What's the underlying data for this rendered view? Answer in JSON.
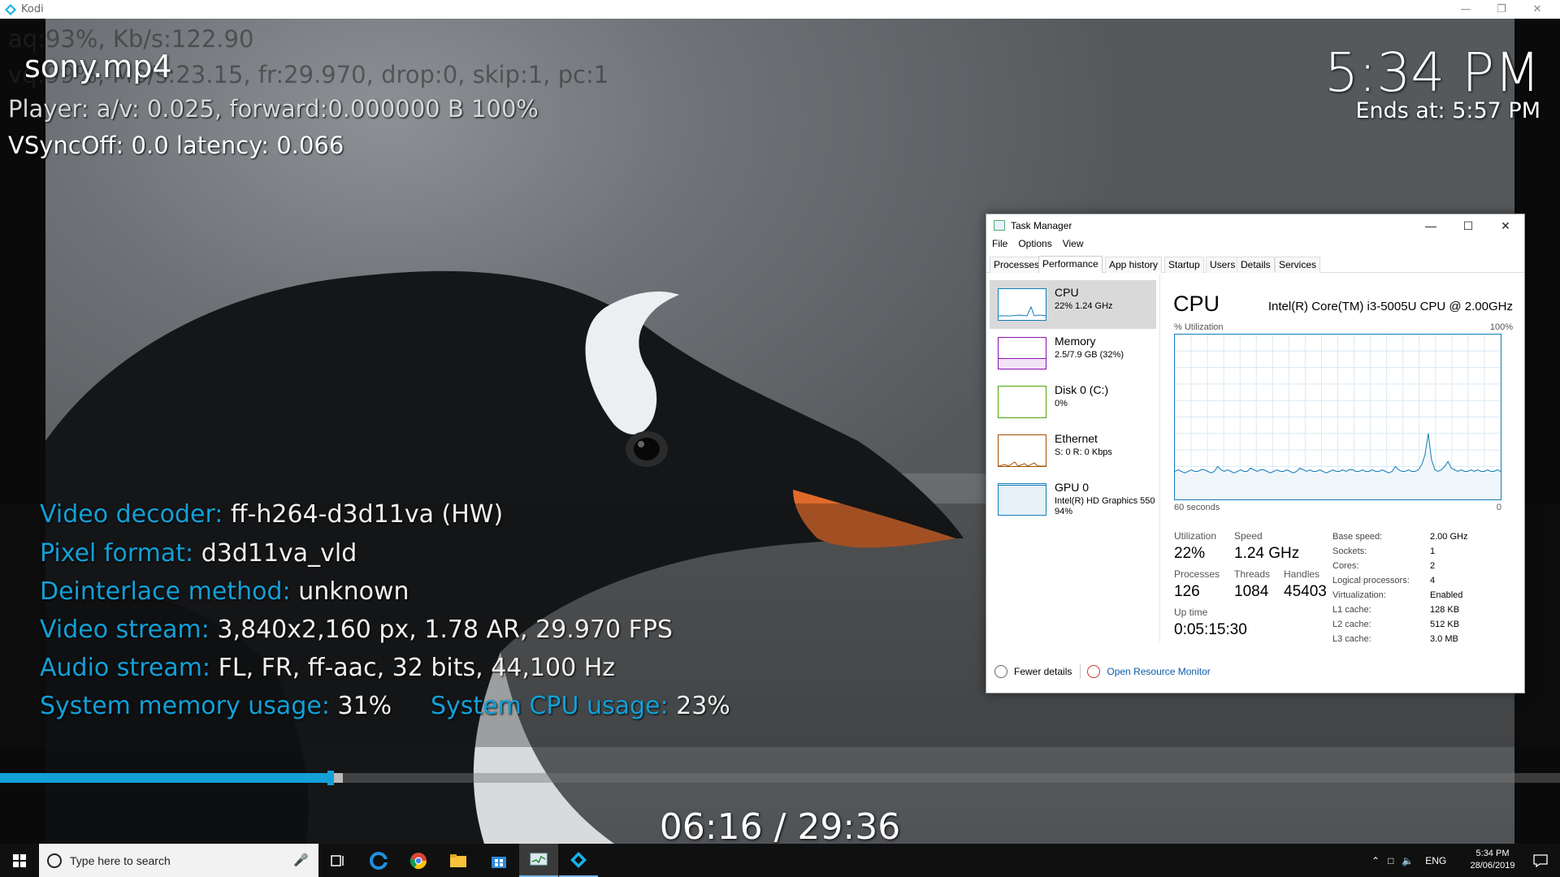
{
  "kodi_window": {
    "title": "Kodi"
  },
  "osd": {
    "debug_audio": "aq:93%, Kb/s:122.90",
    "debug_video": "vq:99%, Mb/s:23.15, fr:29.970, drop:0, skip:1, pc:1",
    "debug_player": "Player: a/v: 0.025,  forward:0.000000 B 100%",
    "debug_vsync": "VSyncOff: 0.0 latency: 0.066",
    "filename": "sony.mp4",
    "clock": "5:34 PM",
    "ends_at": "Ends at: 5:57 PM",
    "info": {
      "video_decoder_label": "Video decoder:",
      "video_decoder_value": "ff-h264-d3d11va (HW)",
      "pixel_format_label": "Pixel format:",
      "pixel_format_value": "d3d11va_vld",
      "deinterlace_label": "Deinterlace method:",
      "deinterlace_value": "unknown",
      "video_stream_label": "Video stream:",
      "video_stream_value": "3,840x2,160 px, 1.78 AR, 29.970 FPS",
      "audio_stream_label": "Audio stream:",
      "audio_stream_value": "FL, FR, ff-aac, 32 bits, 44,100 Hz",
      "mem_label": "System memory usage:",
      "mem_value": "31%",
      "cpu_label": "System CPU usage:",
      "cpu_value": "23%"
    },
    "time": "06:16 / 29:36",
    "progress_fraction": 0.212,
    "cache_fraction": 0.22,
    "accent_color": "#12a0d7"
  },
  "task_manager": {
    "title": "Task Manager",
    "menu": [
      "File",
      "Options",
      "View"
    ],
    "tabs": [
      "Processes",
      "Performance",
      "App history",
      "Startup",
      "Users",
      "Details",
      "Services"
    ],
    "active_tab": "Performance",
    "sidebar": [
      {
        "name": "CPU",
        "sub": "22% 1.24 GHz",
        "color": "#117dbb"
      },
      {
        "name": "Memory",
        "sub": "2.5/7.9 GB (32%)",
        "color": "#8b12ae"
      },
      {
        "name": "Disk 0 (C:)",
        "sub": "0%",
        "color": "#4da60c"
      },
      {
        "name": "Ethernet",
        "sub": "S: 0 R: 0 Kbps",
        "color": "#a74f01"
      },
      {
        "name": "GPU 0",
        "sub": "Intel(R) HD Graphics 550",
        "sub2": "94%",
        "color": "#117dbb"
      }
    ],
    "cpu": {
      "heading": "CPU",
      "model": "Intel(R) Core(TM) i3-5005U CPU @ 2.00GHz",
      "util_label": "% Utilization",
      "util_max": "100%",
      "window_label": "60 seconds",
      "window_min": "0",
      "utilization_label": "Utilization",
      "utilization": "22%",
      "speed_label": "Speed",
      "speed": "1.24 GHz",
      "processes_label": "Processes",
      "processes": "126",
      "threads_label": "Threads",
      "threads": "1084",
      "handles_label": "Handles",
      "handles": "45403",
      "uptime_label": "Up time",
      "uptime": "0:05:15:30",
      "specs": [
        {
          "k": "Base speed:",
          "v": "2.00 GHz"
        },
        {
          "k": "Sockets:",
          "v": "1"
        },
        {
          "k": "Cores:",
          "v": "2"
        },
        {
          "k": "Logical processors:",
          "v": "4"
        },
        {
          "k": "Virtualization:",
          "v": "Enabled"
        },
        {
          "k": "L1 cache:",
          "v": "128 KB"
        },
        {
          "k": "L2 cache:",
          "v": "512 KB"
        },
        {
          "k": "L3 cache:",
          "v": "3.0 MB"
        }
      ],
      "history": [
        17,
        18,
        17,
        16,
        17,
        18,
        17,
        17,
        18,
        18,
        17,
        16,
        17,
        20,
        18,
        17,
        18,
        17,
        16,
        17,
        18,
        17,
        17,
        19,
        18,
        17,
        18,
        18,
        17,
        16,
        17,
        18,
        17,
        17,
        18,
        17,
        16,
        17,
        19,
        18,
        17,
        18,
        17,
        17,
        18,
        17,
        16,
        17,
        18,
        17,
        17,
        18,
        17,
        18,
        18,
        17,
        17,
        18,
        17,
        17,
        18,
        17,
        17,
        18,
        17,
        16,
        17,
        20,
        18,
        17,
        17,
        18,
        17,
        17,
        18,
        21,
        27,
        40,
        24,
        18,
        17,
        18,
        20,
        23,
        19,
        18,
        17,
        18,
        17,
        17,
        18,
        17,
        18,
        17,
        17,
        18,
        17,
        17,
        18,
        17
      ]
    },
    "fewer_details": "Fewer details",
    "open_resource_monitor": "Open Resource Monitor"
  },
  "taskbar": {
    "search_placeholder": "Type here to search",
    "lang": "ENG",
    "time": "5:34 PM",
    "date": "28/06/2019"
  }
}
